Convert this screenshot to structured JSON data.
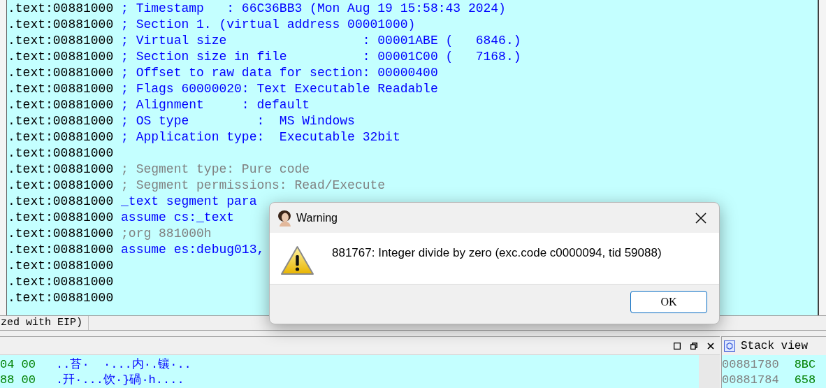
{
  "code_lines": [
    {
      "address": ".text:00881000",
      "text": "; Timestamp   : 66C36BB3 (Mon Aug 19 15:58:43 2024)",
      "kind": "comment"
    },
    {
      "address": ".text:00881000",
      "text": "; Section 1. (virtual address 00001000)",
      "kind": "comment"
    },
    {
      "address": ".text:00881000",
      "text": "; Virtual size                  : 00001ABE (   6846.)",
      "kind": "comment"
    },
    {
      "address": ".text:00881000",
      "text": "; Section size in file          : 00001C00 (   7168.)",
      "kind": "comment"
    },
    {
      "address": ".text:00881000",
      "text": "; Offset to raw data for section: 00000400",
      "kind": "comment"
    },
    {
      "address": ".text:00881000",
      "text": "; Flags 60000020: Text Executable Readable",
      "kind": "comment"
    },
    {
      "address": ".text:00881000",
      "text": "; Alignment     : default",
      "kind": "comment"
    },
    {
      "address": ".text:00881000",
      "text": "; OS type         :  MS Windows",
      "kind": "comment"
    },
    {
      "address": ".text:00881000",
      "text": "; Application type:  Executable 32bit",
      "kind": "comment"
    },
    {
      "address": ".text:00881000",
      "kind": "empty"
    },
    {
      "address": ".text:00881000",
      "text": "; Segment type: Pure code",
      "kind": "note"
    },
    {
      "address": ".text:00881000",
      "text": "; Segment permissions: Read/Execute",
      "kind": "note"
    },
    {
      "address": ".text:00881000",
      "text": "_text segment para",
      "kind": "code"
    },
    {
      "address": ".text:00881000",
      "text": "assume cs:_text",
      "kind": "code"
    },
    {
      "address": ".text:00881000",
      "text": ";org 881000h",
      "kind": "note"
    },
    {
      "address": ".text:00881000",
      "text": "assume es:debug013,",
      "kind": "code"
    },
    {
      "address": ".text:00881000",
      "kind": "empty"
    },
    {
      "address": ".text:00881000",
      "kind": "empty"
    },
    {
      "address": ".text:00881000",
      "kind": "empty"
    }
  ],
  "status_text": "zed with EIP)",
  "hex_view": {
    "rows": [
      {
        "hex": "04 00",
        "ascii": "..苔·  ·...内·.镶·.."
      },
      {
        "hex": "88 00",
        "ascii": ".幵·...饮·}碢·h...."
      }
    ]
  },
  "stack_view": {
    "title": "Stack view",
    "rows": [
      {
        "address": "00881780",
        "value": "8BC"
      },
      {
        "address": "00881784",
        "value": "658"
      }
    ]
  },
  "dialog": {
    "title": "Warning",
    "message": "881767: Integer divide by zero (exc.code c0000094, tid 59088)",
    "button": "OK"
  }
}
